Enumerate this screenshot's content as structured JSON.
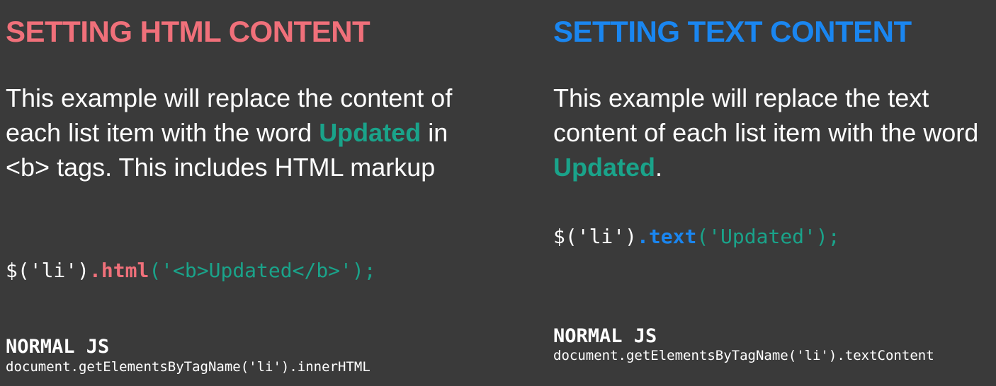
{
  "colors": {
    "background": "#3a3a3a",
    "html_heading": "#f0707a",
    "text_heading": "#1a86f0",
    "highlight": "#1aa38a"
  },
  "left": {
    "heading": "SETTING HTML CONTENT",
    "desc_part1": "This example will replace the content of each list item with the word ",
    "desc_highlight": "Updated",
    "desc_part2": " in <b> tags. This includes HTML markup",
    "code_selector": "$('li')",
    "code_method": ".html",
    "code_args": "('<b>Updated</b>');",
    "normal_title": "NORMAL JS",
    "normal_code": "document.getElementsByTagName('li').innerHTML"
  },
  "right": {
    "heading": "SETTING TEXT CONTENT",
    "desc_part1": "This example will replace the text content of each list item with the word ",
    "desc_highlight": "Updated",
    "desc_part2": ".",
    "code_selector": "$('li')",
    "code_method": ".text",
    "code_args": "('Updated');",
    "normal_title": "NORMAL JS",
    "normal_code": "document.getElementsByTagName('li').textContent"
  }
}
